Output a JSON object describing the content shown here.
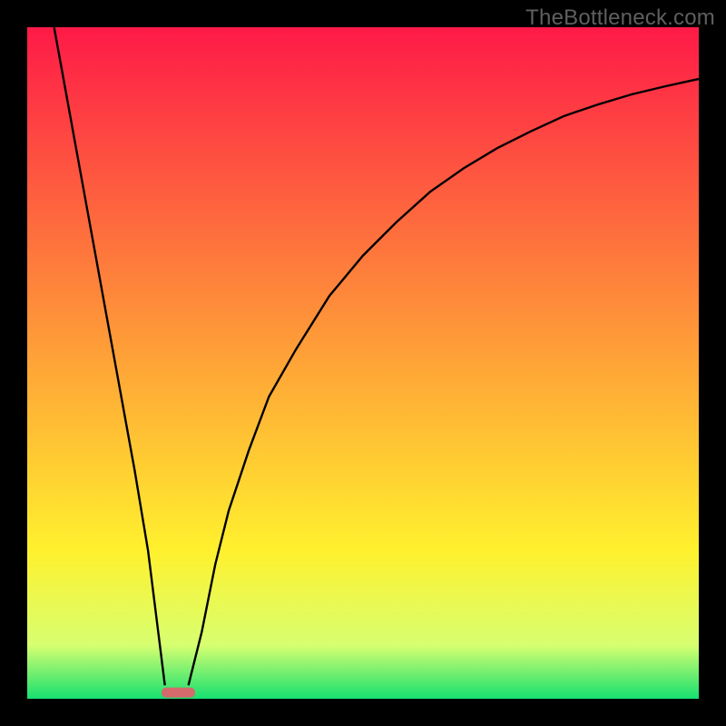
{
  "watermark": "TheBottleneck.com",
  "colors": {
    "frame": "#000000",
    "gradient_top": "#fe1a47",
    "gradient_mid": "#fff12e",
    "gradient_bottom": "#16e070",
    "curve": "#000000",
    "marker": "#d46a6b"
  },
  "chart_data": {
    "type": "line",
    "title": "",
    "xlabel": "",
    "ylabel": "",
    "xlim": [
      0,
      100
    ],
    "ylim": [
      0,
      100
    ],
    "background": "vertical-gradient red→yellow→green",
    "series": [
      {
        "name": "left-branch",
        "x": [
          4,
          6,
          8,
          10,
          12,
          14,
          16,
          18,
          19.5,
          20.5
        ],
        "y": [
          100,
          89,
          78,
          67,
          56,
          45,
          34,
          22,
          10,
          2
        ]
      },
      {
        "name": "right-branch",
        "x": [
          24,
          26,
          28,
          30,
          33,
          36,
          40,
          45,
          50,
          55,
          60,
          65,
          70,
          75,
          80,
          85,
          90,
          95,
          100
        ],
        "y": [
          2,
          10,
          20,
          28,
          37,
          45,
          52,
          60,
          66,
          71,
          75.5,
          79,
          82,
          84.5,
          86.8,
          88.5,
          90,
          91.2,
          92.3
        ]
      }
    ],
    "marker": {
      "x_start": 20,
      "x_end": 25,
      "y": 1.0
    },
    "grid": false,
    "legend": false
  }
}
